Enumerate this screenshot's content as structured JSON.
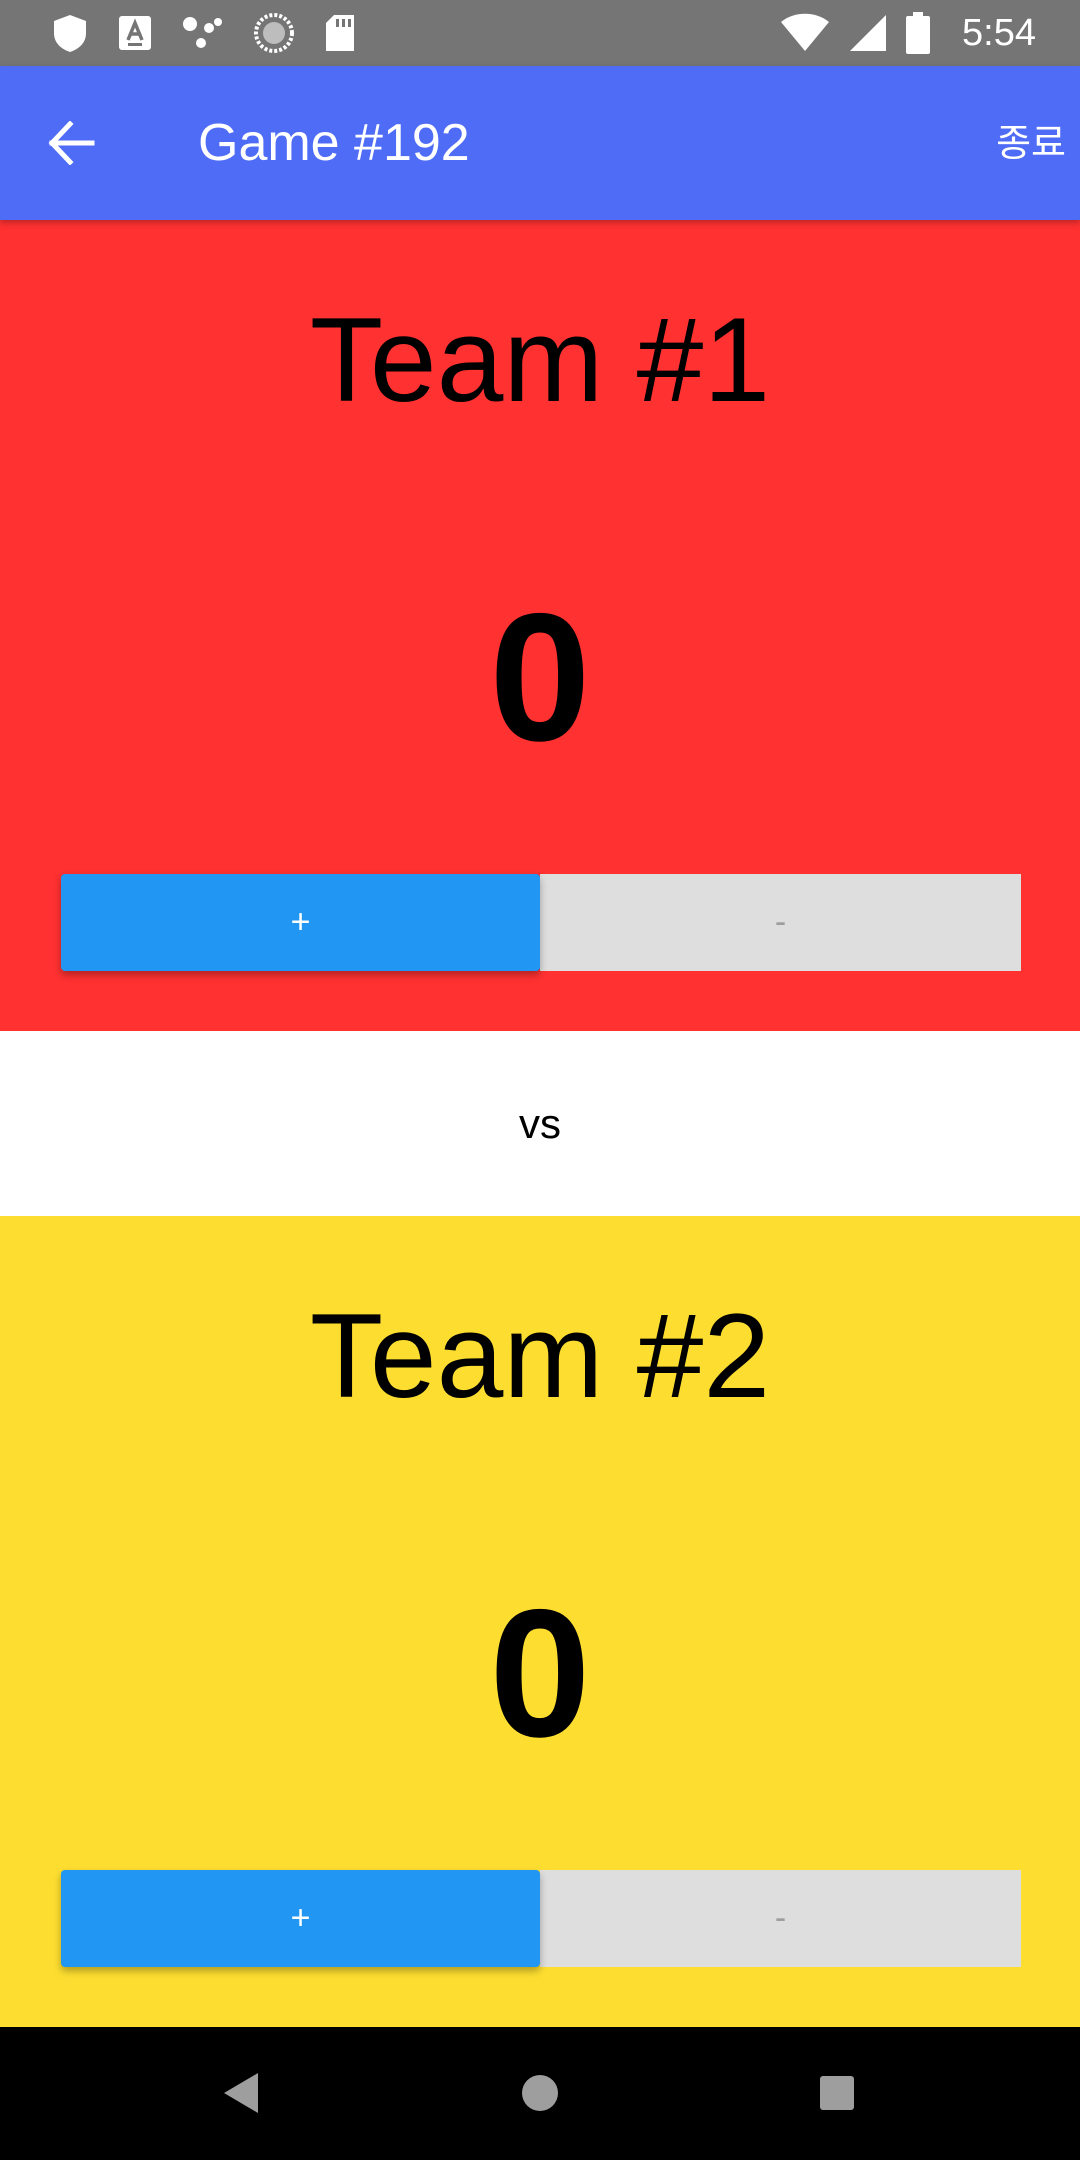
{
  "status_bar": {
    "time": "5:54",
    "left_icons": [
      "shield-icon",
      "text-a-icon",
      "assistant-dots-icon",
      "progress-ring-icon",
      "sd-card-icon"
    ],
    "right_icons": [
      "wifi-icon",
      "cell-signal-icon",
      "battery-icon"
    ]
  },
  "app_bar": {
    "back_icon": "arrow-left-icon",
    "title": "Game #192",
    "end_label": "종료",
    "color": "#4f6cf7"
  },
  "teams": [
    {
      "name": "Team #1",
      "score": "0",
      "plus_label": "+",
      "minus_label": "-",
      "color": "#ff3131"
    },
    {
      "name": "Team #2",
      "score": "0",
      "plus_label": "+",
      "minus_label": "-",
      "color": "#fdde30"
    }
  ],
  "vs_label": "vs",
  "colors": {
    "plus_button": "#2196f3",
    "minus_button": "#dedede"
  },
  "nav_bar": {
    "icons": [
      "nav-back-icon",
      "nav-home-icon",
      "nav-recents-icon"
    ]
  }
}
